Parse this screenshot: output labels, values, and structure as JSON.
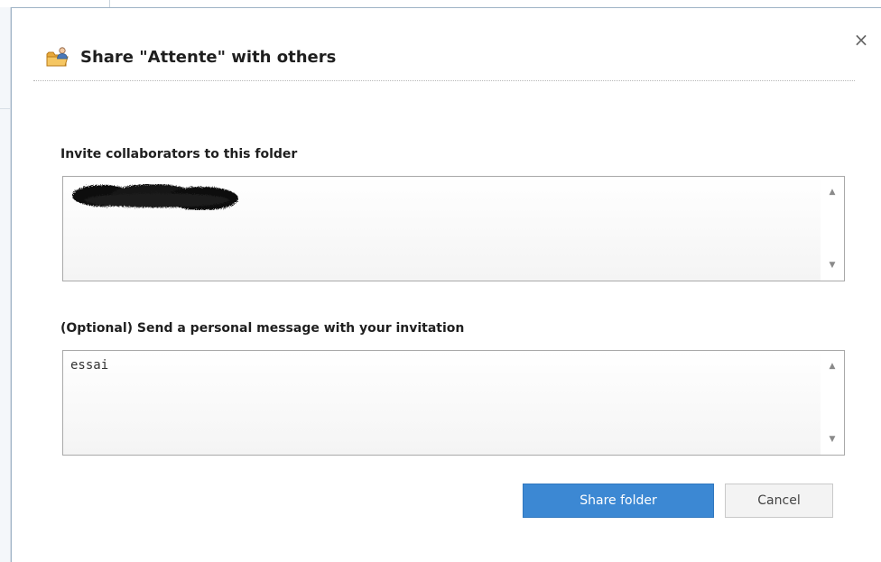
{
  "dialog": {
    "title": "Share \"Attente\" with others",
    "close_symbol": "×",
    "icon": "share-folder-icon"
  },
  "invite": {
    "label": "Invite collaborators to this folder",
    "value": "",
    "redacted": true
  },
  "message": {
    "label": "(Optional) Send a personal message with your invitation",
    "value": "essai"
  },
  "scroll": {
    "up_symbol": "▲",
    "down_symbol": "▼"
  },
  "buttons": {
    "share_label": "Share folder",
    "cancel_label": "Cancel"
  },
  "colors": {
    "primary": "#3c88d3",
    "heading_bg": "#1a7a68"
  }
}
